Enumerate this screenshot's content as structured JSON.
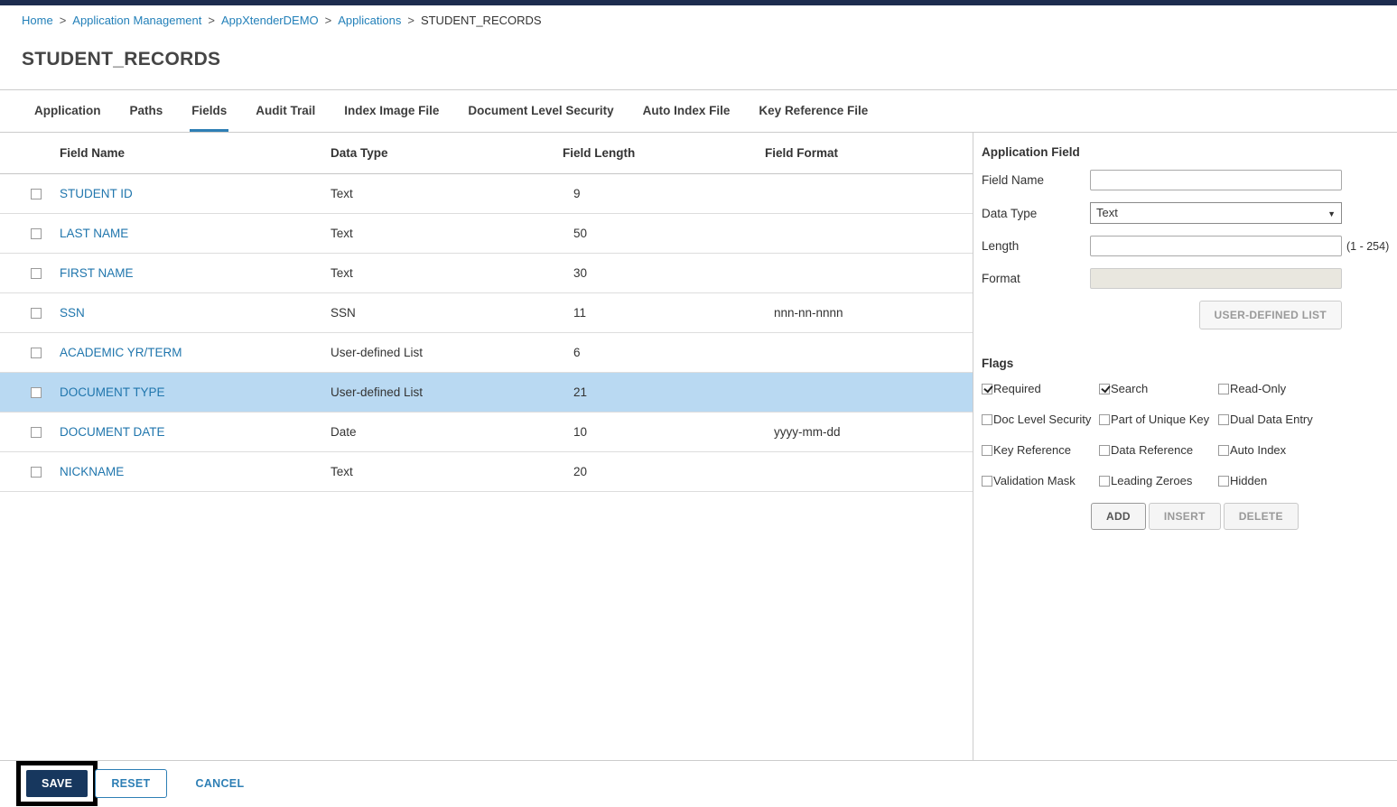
{
  "page": {
    "title": "STUDENT_RECORDS"
  },
  "breadcrumb": {
    "separator": ">",
    "items": [
      {
        "label": "Home",
        "link": true
      },
      {
        "label": "Application Management",
        "link": true
      },
      {
        "label": "AppXtenderDEMO",
        "link": true
      },
      {
        "label": "Applications",
        "link": true
      },
      {
        "label": "STUDENT_RECORDS",
        "link": false
      }
    ]
  },
  "tabs": [
    {
      "label": "Application",
      "active": false
    },
    {
      "label": "Paths",
      "active": false
    },
    {
      "label": "Fields",
      "active": true
    },
    {
      "label": "Audit Trail",
      "active": false
    },
    {
      "label": "Index Image File",
      "active": false
    },
    {
      "label": "Document Level Security",
      "active": false
    },
    {
      "label": "Auto Index File",
      "active": false
    },
    {
      "label": "Key Reference File",
      "active": false
    }
  ],
  "fields_table": {
    "columns": [
      "Field Name",
      "Data Type",
      "Field Length",
      "Field Format"
    ],
    "rows": [
      {
        "name": "STUDENT ID",
        "data_type": "Text",
        "length": "9",
        "format": "",
        "selected": false
      },
      {
        "name": "LAST NAME",
        "data_type": "Text",
        "length": "50",
        "format": "",
        "selected": false
      },
      {
        "name": "FIRST NAME",
        "data_type": "Text",
        "length": "30",
        "format": "",
        "selected": false
      },
      {
        "name": "SSN",
        "data_type": "SSN",
        "length": "11",
        "format": "nnn-nn-nnnn",
        "selected": false
      },
      {
        "name": "ACADEMIC YR/TERM",
        "data_type": "User-defined List",
        "length": "6",
        "format": "",
        "selected": false
      },
      {
        "name": "DOCUMENT TYPE",
        "data_type": "User-defined List",
        "length": "21",
        "format": "",
        "selected": true
      },
      {
        "name": "DOCUMENT DATE",
        "data_type": "Date",
        "length": "10",
        "format": "yyyy-mm-dd",
        "selected": false
      },
      {
        "name": "NICKNAME",
        "data_type": "Text",
        "length": "20",
        "format": "",
        "selected": false
      }
    ]
  },
  "application_field": {
    "title": "Application Field",
    "field_name_label": "Field Name",
    "field_name_value": "",
    "data_type_label": "Data Type",
    "data_type_value": "Text",
    "length_label": "Length",
    "length_value": "",
    "length_hint": "(1 - 254)",
    "format_label": "Format",
    "format_value": "",
    "user_defined_list_button": "USER-DEFINED LIST"
  },
  "flags": {
    "title": "Flags",
    "items": [
      {
        "label": "Required",
        "checked": true
      },
      {
        "label": "Search",
        "checked": true
      },
      {
        "label": "Read-Only",
        "checked": false
      },
      {
        "label": "Doc Level Security",
        "checked": false
      },
      {
        "label": "Part of Unique Key",
        "checked": false
      },
      {
        "label": "Dual Data Entry",
        "checked": false
      },
      {
        "label": "Key Reference",
        "checked": false
      },
      {
        "label": "Data Reference",
        "checked": false
      },
      {
        "label": "Auto Index",
        "checked": false
      },
      {
        "label": "Validation Mask",
        "checked": false
      },
      {
        "label": "Leading Zeroes",
        "checked": false
      },
      {
        "label": "Hidden",
        "checked": false
      }
    ]
  },
  "field_actions": {
    "add": "ADD",
    "insert": "INSERT",
    "delete": "DELETE"
  },
  "footer": {
    "save": "SAVE",
    "reset": "RESET",
    "cancel": "CANCEL"
  },
  "colors": {
    "accent": "#2e7fb5",
    "topbar": "#1d2c4f",
    "selected_row": "#b9d9f2",
    "save_button": "#17375e",
    "link": "#2380b9"
  }
}
